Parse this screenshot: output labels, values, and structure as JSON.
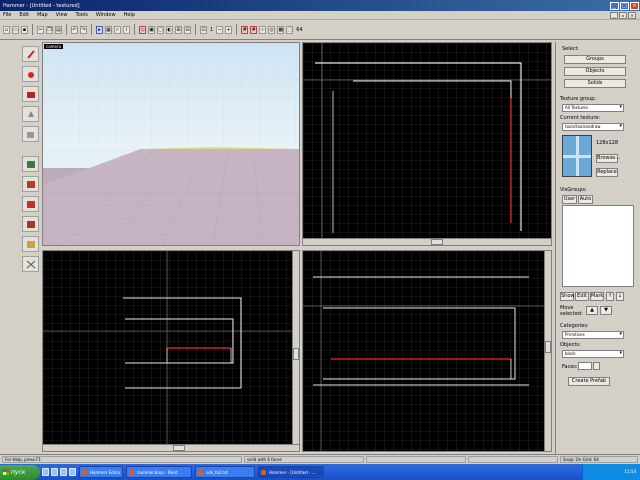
{
  "window": {
    "title": "Hammer - [Untitled - textured]"
  },
  "menu": {
    "items": [
      "File",
      "Edit",
      "Map",
      "View",
      "Tools",
      "Window",
      "Help"
    ]
  },
  "toolbar": {
    "grid_label": "1",
    "zoom_label": "64"
  },
  "viewports": {
    "camera_label": "camera"
  },
  "right_panel": {
    "select_label": "Select:",
    "groups_button": "Groups",
    "objects_button": "Objects",
    "solids_button": "Solids",
    "texture_group_label": "Texture group:",
    "texture_group_value": "All Textures",
    "current_texture_label": "Current texture:",
    "current_texture_value": "tools/toolsnodraw",
    "texture_size": "128x128",
    "browse_button": "Browse...",
    "replace_button": "Replace",
    "visgroups_label": "VisGroups:",
    "user_tab": "User",
    "auto_tab": "Auto",
    "show_button": "Show",
    "edit_button": "Edit",
    "mark_button": "Mark",
    "move_selected_label": "Move selected:",
    "categories_label": "Categories:",
    "categories_value": "Primitives",
    "objects_label": "Objects:",
    "objects_value": "block",
    "faces_label": "Faces:",
    "create_prefab_button": "Create Prefab"
  },
  "status": {
    "left": "For Help, press F1",
    "selection": "solid with 6 faces",
    "right": "Snap: On Grid: 64"
  },
  "taskbar": {
    "start": "пуск",
    "tasks": [
      "Hammer Editor",
      "hammer.bmp - Paint",
      "sdk_hl2.txt",
      "Hammer - [Untitled - ..."
    ],
    "clock": "11:54"
  },
  "colors": {
    "title_bar": "#0a246a",
    "viewport_bg": "#000000",
    "grid": "#3a3a3a",
    "selection": "#c82020",
    "brush_outline": "#ffffff",
    "sky": "#d9eef8",
    "floor": "#c5b3c0"
  }
}
